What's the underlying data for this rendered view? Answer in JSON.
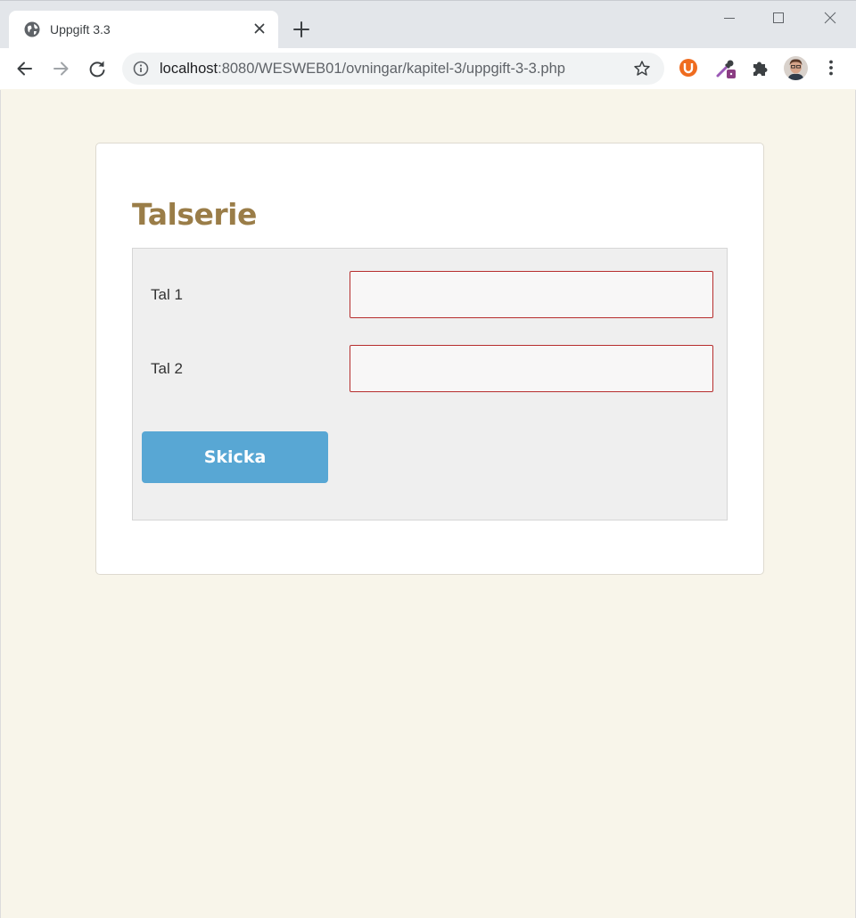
{
  "browser": {
    "tab": {
      "title": "Uppgift 3.3"
    },
    "address": {
      "host": "localhost",
      "path": ":8080/WESWEB01/ovningar/kapitel-3/uppgift-3-3.php"
    },
    "colors": {
      "tabstrip": "#e3e6ea",
      "omnibox": "#f1f3f4",
      "ext_u": "#ef6c1f",
      "ext_picker": "#8b3d83"
    },
    "icons": [
      "globe-icon",
      "close-icon",
      "plus-icon",
      "minimize-icon",
      "maximize-icon",
      "window-close-icon",
      "back-arrow-icon",
      "forward-arrow-icon",
      "reload-icon",
      "info-icon",
      "star-icon",
      "u-extension-icon",
      "color-picker-extension-icon",
      "puzzle-icon",
      "avatar",
      "kebab-menu-icon"
    ]
  },
  "page": {
    "background": "#f8f5ea",
    "title": "Talserie",
    "title_color": "#9a7d48",
    "form": {
      "fields": [
        {
          "label": "Tal 1",
          "value": ""
        },
        {
          "label": "Tal 2",
          "value": ""
        }
      ],
      "submit_label": "Skicka",
      "submit_color": "#58a7d4",
      "error_border_color": "#b62d2d"
    }
  }
}
